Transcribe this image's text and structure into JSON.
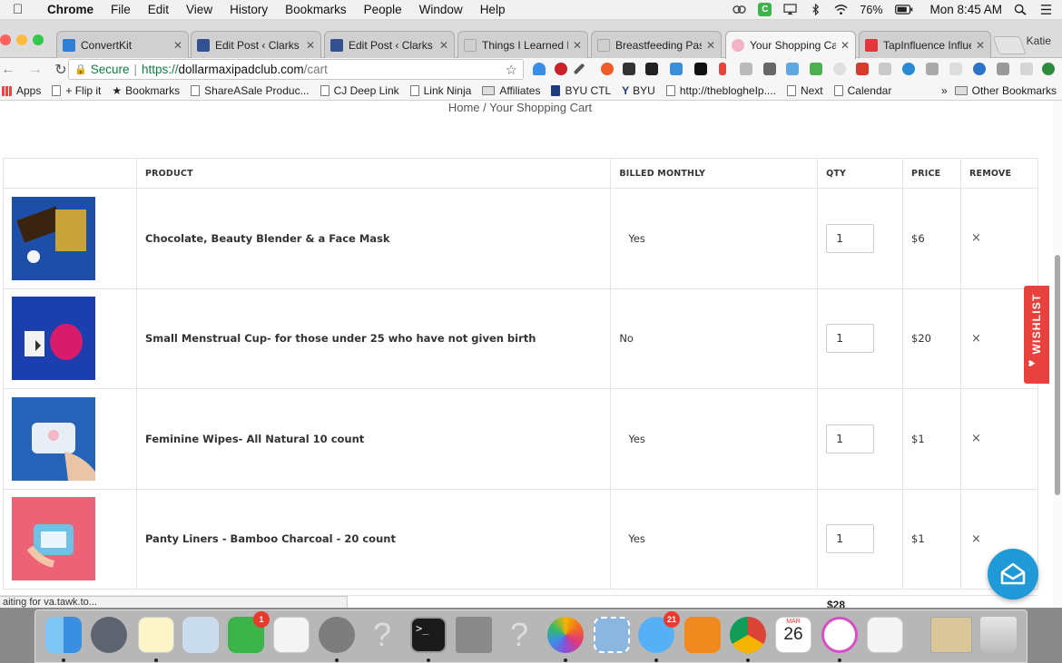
{
  "menubar": {
    "app": "Chrome",
    "items": [
      "File",
      "Edit",
      "View",
      "History",
      "Bookmarks",
      "People",
      "Window",
      "Help"
    ],
    "battery": "76%",
    "clock": "Mon 8:45 AM",
    "c_icon": "C"
  },
  "tabs": [
    {
      "label": "ConvertKit",
      "color": "#2d7fd8"
    },
    {
      "label": "Edit Post ‹ Clarks C",
      "color": "#33508f"
    },
    {
      "label": "Edit Post ‹ Clarks C",
      "color": "#33508f"
    },
    {
      "label": "Things I Learned F",
      "color": "#bbbbbb"
    },
    {
      "label": "Breastfeeding Past",
      "color": "#bbbbbb"
    },
    {
      "label": "Your Shopping Car",
      "color": "#f2b3c4"
    },
    {
      "label": "TapInfluence Influe",
      "color": "#e2353c"
    }
  ],
  "profile_name": "Katie",
  "omnibox": {
    "secure_label": "Secure",
    "scheme": "https://",
    "host": "dollarmaxipadclub.com",
    "path": "/cart"
  },
  "bookmarks": [
    {
      "label": "Apps",
      "kind": "apps"
    },
    {
      "label": "+ Flip it",
      "kind": "page"
    },
    {
      "label": "Bookmarks",
      "kind": "star"
    },
    {
      "label": "ShareASale Produc...",
      "kind": "page"
    },
    {
      "label": "CJ Deep Link",
      "kind": "page"
    },
    {
      "label": "Link Ninja",
      "kind": "page"
    },
    {
      "label": "Affiliates",
      "kind": "folder"
    },
    {
      "label": "BYU CTL",
      "kind": "page"
    },
    {
      "label": "BYU",
      "kind": "byu"
    },
    {
      "label": "http://theblogheIp....",
      "kind": "page"
    },
    {
      "label": "Next",
      "kind": "page"
    },
    {
      "label": "Calendar",
      "kind": "page"
    }
  ],
  "bookmarks_more": "»",
  "bookmarks_other": "Other Bookmarks",
  "breadcrumb": {
    "home": "Home",
    "sep": "/",
    "current": "Your Shopping Cart"
  },
  "cart": {
    "headers": {
      "product": "PRODUCT",
      "billed": "BILLED MONTHLY",
      "qty": "QTY",
      "price": "PRICE",
      "remove": "REMOVE"
    },
    "rows": [
      {
        "name": "Chocolate, Beauty Blender & a Face Mask",
        "billed": "Yes",
        "qty": "1",
        "price": "$6",
        "remove": "×",
        "thumb_bg": "#1e4fa8",
        "thumb_item": "#c9a33a"
      },
      {
        "name": "Small Menstrual Cup- for those under 25 who have not given birth",
        "billed": "No",
        "qty": "1",
        "price": "$20",
        "remove": "×",
        "thumb_bg": "#1c3fb0",
        "thumb_item": "#d81b6b"
      },
      {
        "name": "Feminine Wipes- All Natural 10 count",
        "billed": "Yes",
        "qty": "1",
        "price": "$1",
        "remove": "×",
        "thumb_bg": "#2563b8",
        "thumb_item": "#e8eef5"
      },
      {
        "name": "Panty Liners - Bamboo Charcoal - 20 count",
        "billed": "Yes",
        "qty": "1",
        "price": "$1",
        "remove": "×",
        "thumb_bg": "#ee6277",
        "thumb_item": "#6fc1e6"
      }
    ],
    "subtotal": "$28"
  },
  "wishlist_label": "WISHLIST",
  "status_text": "aiting for va.tawk.to...",
  "dock_badges": {
    "facetime": "1",
    "messages": "21"
  },
  "calendar": {
    "month": "MAR",
    "day": "26"
  }
}
